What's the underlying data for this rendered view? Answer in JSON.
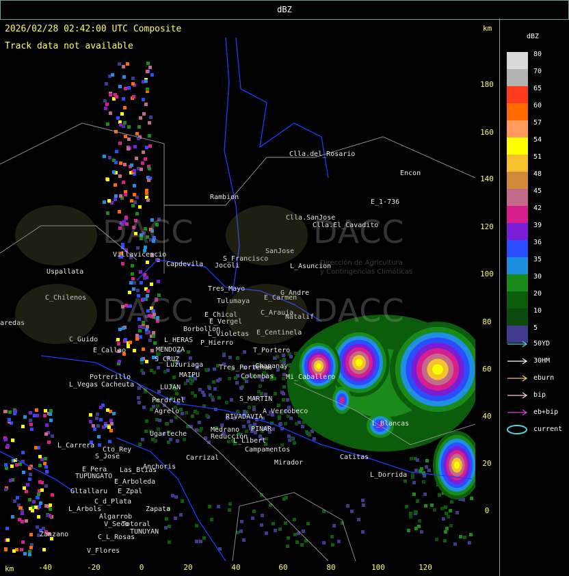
{
  "window": {
    "title": "dBZ"
  },
  "header": {
    "timestamp": "2026/02/28 02:42:00 UTC Composite",
    "track_message": "Track data not available",
    "unit_top": "km",
    "unit_bottom": "km"
  },
  "axes": {
    "y_ticks": [
      "180",
      "160",
      "140",
      "120",
      "100",
      "80",
      "60",
      "40",
      "20",
      "0"
    ],
    "x_ticks": [
      "-40",
      "-20",
      "0",
      "20",
      "40",
      "60",
      "80",
      "100",
      "120"
    ]
  },
  "legend": {
    "title": "dBZ",
    "levels": [
      {
        "value": "80",
        "color": "#d9d9d9"
      },
      {
        "value": "70",
        "color": "#b3b3b3"
      },
      {
        "value": "65",
        "color": "#ff3b1f"
      },
      {
        "value": "60",
        "color": "#ff6a00"
      },
      {
        "value": "57",
        "color": "#ff9a5c"
      },
      {
        "value": "54",
        "color": "#ffff00"
      },
      {
        "value": "51",
        "color": "#f5c22e"
      },
      {
        "value": "48",
        "color": "#d08a3a"
      },
      {
        "value": "45",
        "color": "#c26a8a"
      },
      {
        "value": "42",
        "color": "#d61e8c"
      },
      {
        "value": "39",
        "color": "#7a1ed6"
      },
      {
        "value": "36",
        "color": "#2a4dff"
      },
      {
        "value": "35",
        "color": "#1f8fe0"
      },
      {
        "value": "30",
        "color": "#1a8a1a"
      },
      {
        "value": "20",
        "color": "#0b5c0b"
      },
      {
        "value": "10",
        "color": "#0e4a0e"
      },
      {
        "value": "5",
        "color": "#3f3a8c"
      }
    ],
    "tracks": [
      {
        "label": "50YD",
        "color": "#4fd6e0"
      },
      {
        "label": "30HM",
        "color": "#ffffff"
      },
      {
        "label": "eburn",
        "color": "#f0c080"
      },
      {
        "label": "bip",
        "color": "#ffc8d8"
      },
      {
        "label": "eb+bip",
        "color": "#e040e0"
      },
      {
        "label": "current",
        "color": "#4fd6e0"
      }
    ]
  },
  "watermark": {
    "brand": "DACC",
    "line1": "Dirección de Agricultura",
    "line2": "y Contingencias Climáticas"
  },
  "places": [
    "Clla.del_Rosario",
    "Encon",
    "E_1-736",
    "Rambion",
    "Clla.SanJose",
    "Clla.El_Cavadito",
    "Villavicencio",
    "Uspallata",
    "Capdevila",
    "Jocoli",
    "S_Francisco",
    "SanJose",
    "L_Asuncion",
    "Tres_Mayo",
    "Tulumaya",
    "E_Carmen",
    "G_Andre",
    "C_Chilenos",
    "E_Chical",
    "E_Vergel",
    "C_Arauja",
    "Natalif",
    "aredas",
    "Borbollon",
    "L_Violetas",
    "E_Centinela",
    "P_Hierro",
    "C_Guido",
    "E_Callao",
    "L_HERAS",
    "MENDOZA",
    "S_CRUZ",
    "Luzuriaga",
    "MAIPU",
    "T_Portero",
    "Tres_Porteñas",
    "Chapanay",
    "Colombas",
    "Mi_Caballero",
    "Potrerillo",
    "L_Vegas",
    "Cacheuta",
    "LUJAN",
    "Perdriel",
    "Agrelo",
    "S_MARTIN",
    "A_Vercobeco",
    "RIVADAVIA",
    "Ugarteche",
    "Medrano",
    "Reducción",
    "PINAR",
    "L_Libert",
    "L_Blancas",
    "L_Carrera",
    "Cto_Rey",
    "S_Jose",
    "Carrizal",
    "Campamentos",
    "Catitas",
    "E_Pera",
    "TUPUNGATO",
    "Anchoris",
    "Las_Btias",
    "Mirador",
    "L_Dorrida",
    "E_Arboleda",
    "Gltallaru",
    "E_Zpal",
    "C_d_Plata",
    "L_Arbols",
    "Zapata",
    "Algarrob",
    "V_Seco",
    "Totoral",
    "TUNUYAN",
    "C_L_Rosas",
    "Zanzano",
    "V_Flores"
  ]
}
